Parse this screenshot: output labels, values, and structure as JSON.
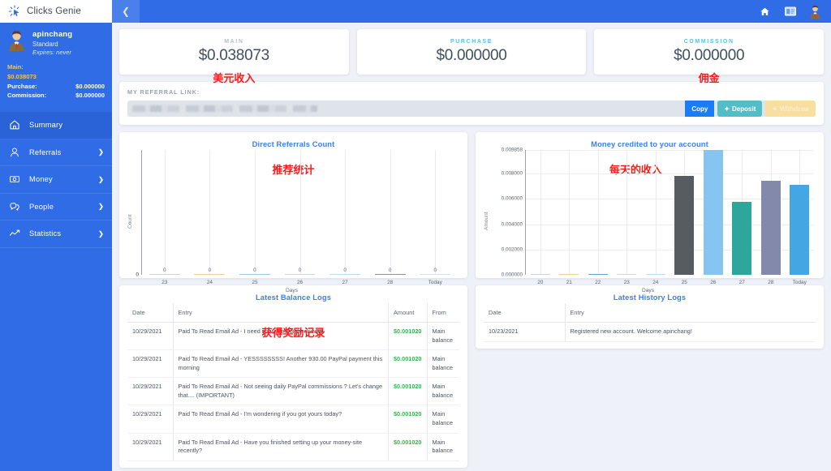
{
  "brand": {
    "name": "Clicks Genie",
    "logo_icon": "cursor-click-icon"
  },
  "sidebar": {
    "profile": {
      "username": "apinchang",
      "plan": "Standard",
      "expires": "Expires: never",
      "avatar_icon": "user-avatar-icon",
      "balances": [
        {
          "label": "Main:",
          "value": "$0.038073",
          "highlight": true
        },
        {
          "label": "Purchase:",
          "value": "$0.000000",
          "highlight": false
        },
        {
          "label": "Commission:",
          "value": "$0.000000",
          "highlight": false
        }
      ]
    },
    "items": [
      {
        "label": "Summary",
        "icon": "home-icon",
        "active": true,
        "chevron": ""
      },
      {
        "label": "Referrals",
        "icon": "users-icon",
        "active": false,
        "chevron": "❯"
      },
      {
        "label": "Money",
        "icon": "banknote-icon",
        "active": false,
        "chevron": "❯"
      },
      {
        "label": "People",
        "icon": "chat-icon",
        "active": false,
        "chevron": "❯"
      },
      {
        "label": "Statistics",
        "icon": "line-chart-icon",
        "active": false,
        "chevron": "❯"
      }
    ]
  },
  "topbar": {
    "collapse_icon": "chevron-left-icon",
    "icons": [
      {
        "name": "home-icon"
      },
      {
        "name": "money-card-icon"
      },
      {
        "name": "user-avatar-icon"
      }
    ]
  },
  "stats": [
    {
      "label": "MAIN",
      "value": "$0.038073",
      "label_color": "gray",
      "annotation": "美元收入"
    },
    {
      "label": "PURCHASE",
      "value": "$0.000000",
      "label_color": "blue",
      "annotation": ""
    },
    {
      "label": "COMMISSION",
      "value": "$0.000000",
      "label_color": "blue",
      "annotation": "佣金"
    }
  ],
  "referral": {
    "title": "MY REFERRAL LINK:",
    "link_value": "",
    "link_placeholder": "",
    "buttons": [
      {
        "label": "Copy",
        "style": "copy",
        "icon": ""
      },
      {
        "label": "Deposit",
        "style": "deposit",
        "icon": "✦"
      },
      {
        "label": "Withdraw",
        "style": "withdraw",
        "icon": "✦"
      }
    ]
  },
  "panels": {
    "referrals_chart_title": "Direct Referrals Count",
    "money_chart_title": "Money credited to your account",
    "balance_logs_title": "Latest Balance Logs",
    "history_logs_title": "Latest History Logs"
  },
  "annotations": {
    "referrals_chart": "推荐统计",
    "money_chart": "每天的收入",
    "balance_logs": "获得奖励记录"
  },
  "chart_data": [
    {
      "type": "bar",
      "title": "Direct Referrals Count",
      "xlabel": "Days",
      "ylabel": "Count",
      "categories": [
        "23",
        "24",
        "25",
        "26",
        "27",
        "28",
        "Today"
      ],
      "values": [
        0,
        0,
        0,
        0,
        0,
        0,
        0
      ],
      "data_labels": [
        "0",
        "0",
        "0",
        "0",
        "0",
        "0",
        "0"
      ],
      "yticks": [
        "0"
      ],
      "ylim": [
        0,
        1
      ],
      "grid": true,
      "legend": "none",
      "bar_colors": [
        "#c9d3df",
        "#f5cf8e",
        "#9ecbec",
        "#d3d8de",
        "#bfdcf2",
        "#8d9298",
        "#cfe3f4"
      ]
    },
    {
      "type": "bar",
      "title": "Money credited to your account",
      "xlabel": "Days",
      "ylabel": "Amount",
      "categories": [
        "20",
        "21",
        "22",
        "23",
        "24",
        "25",
        "26",
        "27",
        "28",
        "Today"
      ],
      "values": [
        0.0,
        0.0,
        0.0,
        0.0,
        0.0,
        0.007795,
        0.009858,
        0.005755,
        0.007449,
        0.007133
      ],
      "yticks": [
        "0.000000",
        "0.002000",
        "0.004000",
        "0.006000",
        "0.008000",
        "0.009858"
      ],
      "ytick_values": [
        0.0,
        0.002,
        0.004,
        0.006,
        0.008,
        0.009858
      ],
      "ylim": [
        0,
        0.009858
      ],
      "grid": true,
      "legend": "none",
      "bar_colors": [
        "#c9d3df",
        "#f5cf8e",
        "#5ba7dd",
        "#d3d8de",
        "#bfdcf2",
        "#575c61",
        "#85c5ef",
        "#2fa69b",
        "#8289ab",
        "#45a6e5"
      ]
    }
  ],
  "balance_logs": {
    "columns": [
      "Date",
      "Entry",
      "Amount",
      "From"
    ],
    "rows": [
      {
        "date": "10/29/2021",
        "entry": "Paid To Read Email Ad - I need your immediate answer",
        "amount": "$0.001020",
        "from": "Main balance"
      },
      {
        "date": "10/29/2021",
        "entry": "Paid To Read Email Ad - YESSSSSSSS! Another 930.00 PayPal payment this morning",
        "amount": "$0.001020",
        "from": "Main balance"
      },
      {
        "date": "10/29/2021",
        "entry": "Paid To Read Email Ad - Not seeing daily PayPal commissions ? Let's change that.... (IMPORTANT)",
        "amount": "$0.001020",
        "from": "Main balance"
      },
      {
        "date": "10/29/2021",
        "entry": "Paid To Read Email Ad - I'm wondering if you got yours today?",
        "amount": "$0.001020",
        "from": "Main balance"
      },
      {
        "date": "10/29/2021",
        "entry": "Paid To Read Email Ad - Have you finished setting up your money-site recently?",
        "amount": "$0.001020",
        "from": "Main balance"
      }
    ]
  },
  "history_logs": {
    "columns": [
      "Date",
      "Entry"
    ],
    "rows": [
      {
        "date": "10/23/2021",
        "entry": "Registered new account. Welcome apinchang!"
      }
    ]
  },
  "colors": {
    "brand_blue": "#2f6ce5",
    "accent_blue": "#3b7ff0",
    "page_bg": "#eef1f7",
    "amount_green": "#35b44a",
    "annotation_red": "#ff1a1a",
    "gold": "#f6c344"
  }
}
